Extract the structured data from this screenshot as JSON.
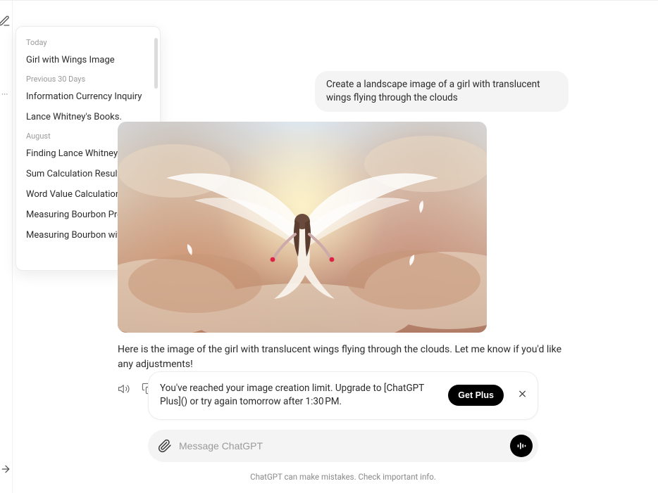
{
  "history": {
    "groups": [
      {
        "label": "Today",
        "items": [
          {
            "label": "Girl with Wings Image"
          }
        ]
      },
      {
        "label": "Previous 30 Days",
        "items": [
          {
            "label": "Information Currency Inquiry"
          },
          {
            "label": "Lance Whitney's Books."
          }
        ]
      },
      {
        "label": "August",
        "items": [
          {
            "label": "Finding Lance Whitney Articles"
          },
          {
            "label": "Sum Calculation Result"
          },
          {
            "label": "Word Value Calculation"
          },
          {
            "label": "Measuring Bourbon Precisely"
          },
          {
            "label": "Measuring Bourbon with Glass"
          }
        ]
      }
    ]
  },
  "conversation": {
    "user_message": "Create a landscape image of a girl with translucent wings flying through the clouds",
    "assistant_message": "Here is the image of the girl with translucent wings flying through the clouds. Let me know if you'd like any adjustments!",
    "image_alt": "girl-with-translucent-wings-flying-through-clouds"
  },
  "limit_banner": {
    "text": "You've reached your image creation limit. Upgrade to [ChatGPT Plus]() or try again tomorrow after 1:30 PM.",
    "cta": "Get Plus"
  },
  "composer": {
    "placeholder": "Message ChatGPT"
  },
  "footer": {
    "note": "ChatGPT can make mistakes. Check important info."
  }
}
